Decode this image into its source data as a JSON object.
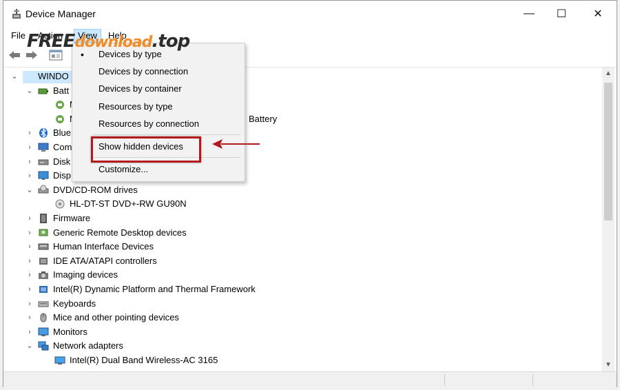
{
  "window": {
    "title": "Device Manager",
    "controls": {
      "minimize": "—",
      "maximize": "☐",
      "close": "✕"
    }
  },
  "menubar": {
    "items": [
      "File",
      "Action",
      "View",
      "Help"
    ],
    "active": "View"
  },
  "watermark": {
    "part1": "FREE",
    "part2": "download",
    "part3": ".top"
  },
  "view_menu": {
    "items": [
      {
        "label": "Devices by type",
        "checked": true
      },
      {
        "label": "Devices by connection",
        "checked": false
      },
      {
        "label": "Devices by container",
        "checked": false
      },
      {
        "label": "Resources by type",
        "checked": false
      },
      {
        "label": "Resources by connection",
        "checked": false
      },
      {
        "label": "Show hidden devices",
        "checked": false
      },
      {
        "label": "Customize...",
        "checked": false
      }
    ],
    "bullet": "•"
  },
  "tree": {
    "root": "WINDOWS",
    "root_visible": "WINDO",
    "items": [
      {
        "label": "Batt",
        "expanded": true,
        "icon": "battery-icon"
      },
      {
        "label": "M",
        "child": true,
        "icon": "battery-device-icon"
      },
      {
        "label": "M",
        "child": true,
        "icon": "battery-device-icon",
        "suffix": "Battery"
      },
      {
        "label": "Blue",
        "icon": "bluetooth-icon"
      },
      {
        "label": "Com",
        "icon": "computer-icon"
      },
      {
        "label": "Disk",
        "icon": "disk-icon"
      },
      {
        "label": "Disp",
        "icon": "display-icon"
      },
      {
        "label": "DVD/CD-ROM drives",
        "expanded": true,
        "icon": "dvd-icon"
      },
      {
        "label": "HL-DT-ST DVD+-RW GU90N",
        "child": true,
        "icon": "dvd-drive-icon"
      },
      {
        "label": "Firmware",
        "icon": "firmware-icon"
      },
      {
        "label": "Generic Remote Desktop devices",
        "icon": "remote-desktop-icon"
      },
      {
        "label": "Human Interface Devices",
        "icon": "hid-icon"
      },
      {
        "label": "IDE ATA/ATAPI controllers",
        "icon": "ide-icon"
      },
      {
        "label": "Imaging devices",
        "icon": "camera-icon"
      },
      {
        "label": "Intel(R) Dynamic Platform and Thermal Framework",
        "icon": "chip-icon"
      },
      {
        "label": "Keyboards",
        "icon": "keyboard-icon"
      },
      {
        "label": "Mice and other pointing devices",
        "icon": "mouse-icon"
      },
      {
        "label": "Monitors",
        "icon": "monitor-icon"
      },
      {
        "label": "Network adapters",
        "expanded": true,
        "icon": "network-icon"
      },
      {
        "label": "Intel(R) Dual Band Wireless-AC 3165",
        "child": true,
        "icon": "network-adapter-icon"
      }
    ]
  },
  "colors": {
    "annotation": "#b3191c",
    "selection": "#cce8ff",
    "watermark_orange": "#f08c2a"
  }
}
